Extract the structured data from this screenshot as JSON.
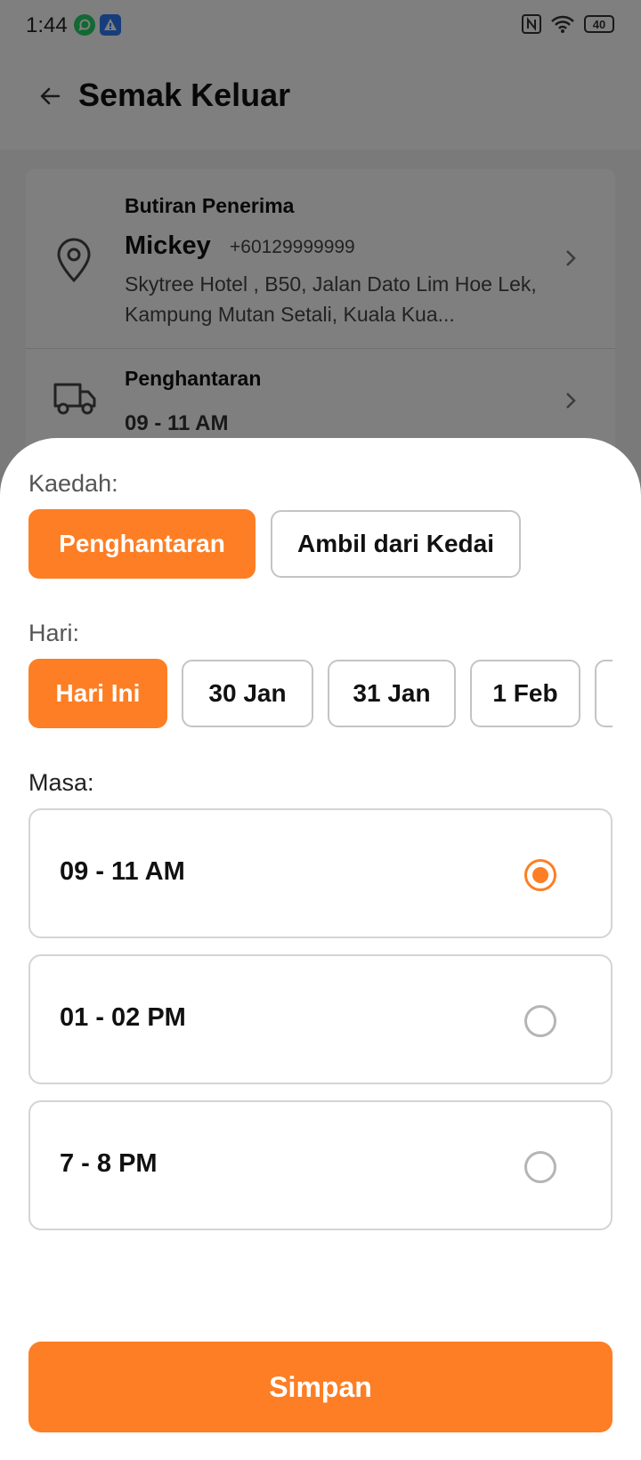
{
  "status_bar": {
    "time": "1:44",
    "battery": "40"
  },
  "header": {
    "title": "Semak Keluar"
  },
  "recipient": {
    "label": "Butiran Penerima",
    "name": "Mickey",
    "phone": "+60129999999",
    "address": "Skytree Hotel , B50, Jalan Dato Lim Hoe Lek, Kampung Mutan Setali, Kuala Kua..."
  },
  "delivery": {
    "label": "Penghantaran",
    "time": "09 - 11 AM"
  },
  "sheet": {
    "method_label": "Kaedah:",
    "methods": [
      {
        "label": "Penghantaran",
        "selected": true
      },
      {
        "label": "Ambil dari Kedai",
        "selected": false
      }
    ],
    "day_label": "Hari:",
    "days": [
      {
        "label": "Hari Ini",
        "selected": true
      },
      {
        "label": "30 Jan",
        "selected": false
      },
      {
        "label": "31 Jan",
        "selected": false
      },
      {
        "label": "1 Feb",
        "selected": false
      },
      {
        "label": "",
        "selected": false
      }
    ],
    "time_label": "Masa:",
    "times": [
      {
        "label": "09 - 11 AM",
        "selected": true
      },
      {
        "label": "01 - 02 PM",
        "selected": false
      },
      {
        "label": "7 - 8 PM",
        "selected": false
      }
    ],
    "save_label": "Simpan"
  },
  "colors": {
    "accent": "#fd7e24",
    "whatsapp": "#25d366",
    "alert": "#2f7cf6"
  },
  "icons": [
    "back-arrow-icon",
    "location-pin-icon",
    "truck-icon",
    "chevron-right-icon",
    "whatsapp-icon",
    "alert-icon",
    "nfc-icon",
    "wifi-icon",
    "battery-icon"
  ]
}
